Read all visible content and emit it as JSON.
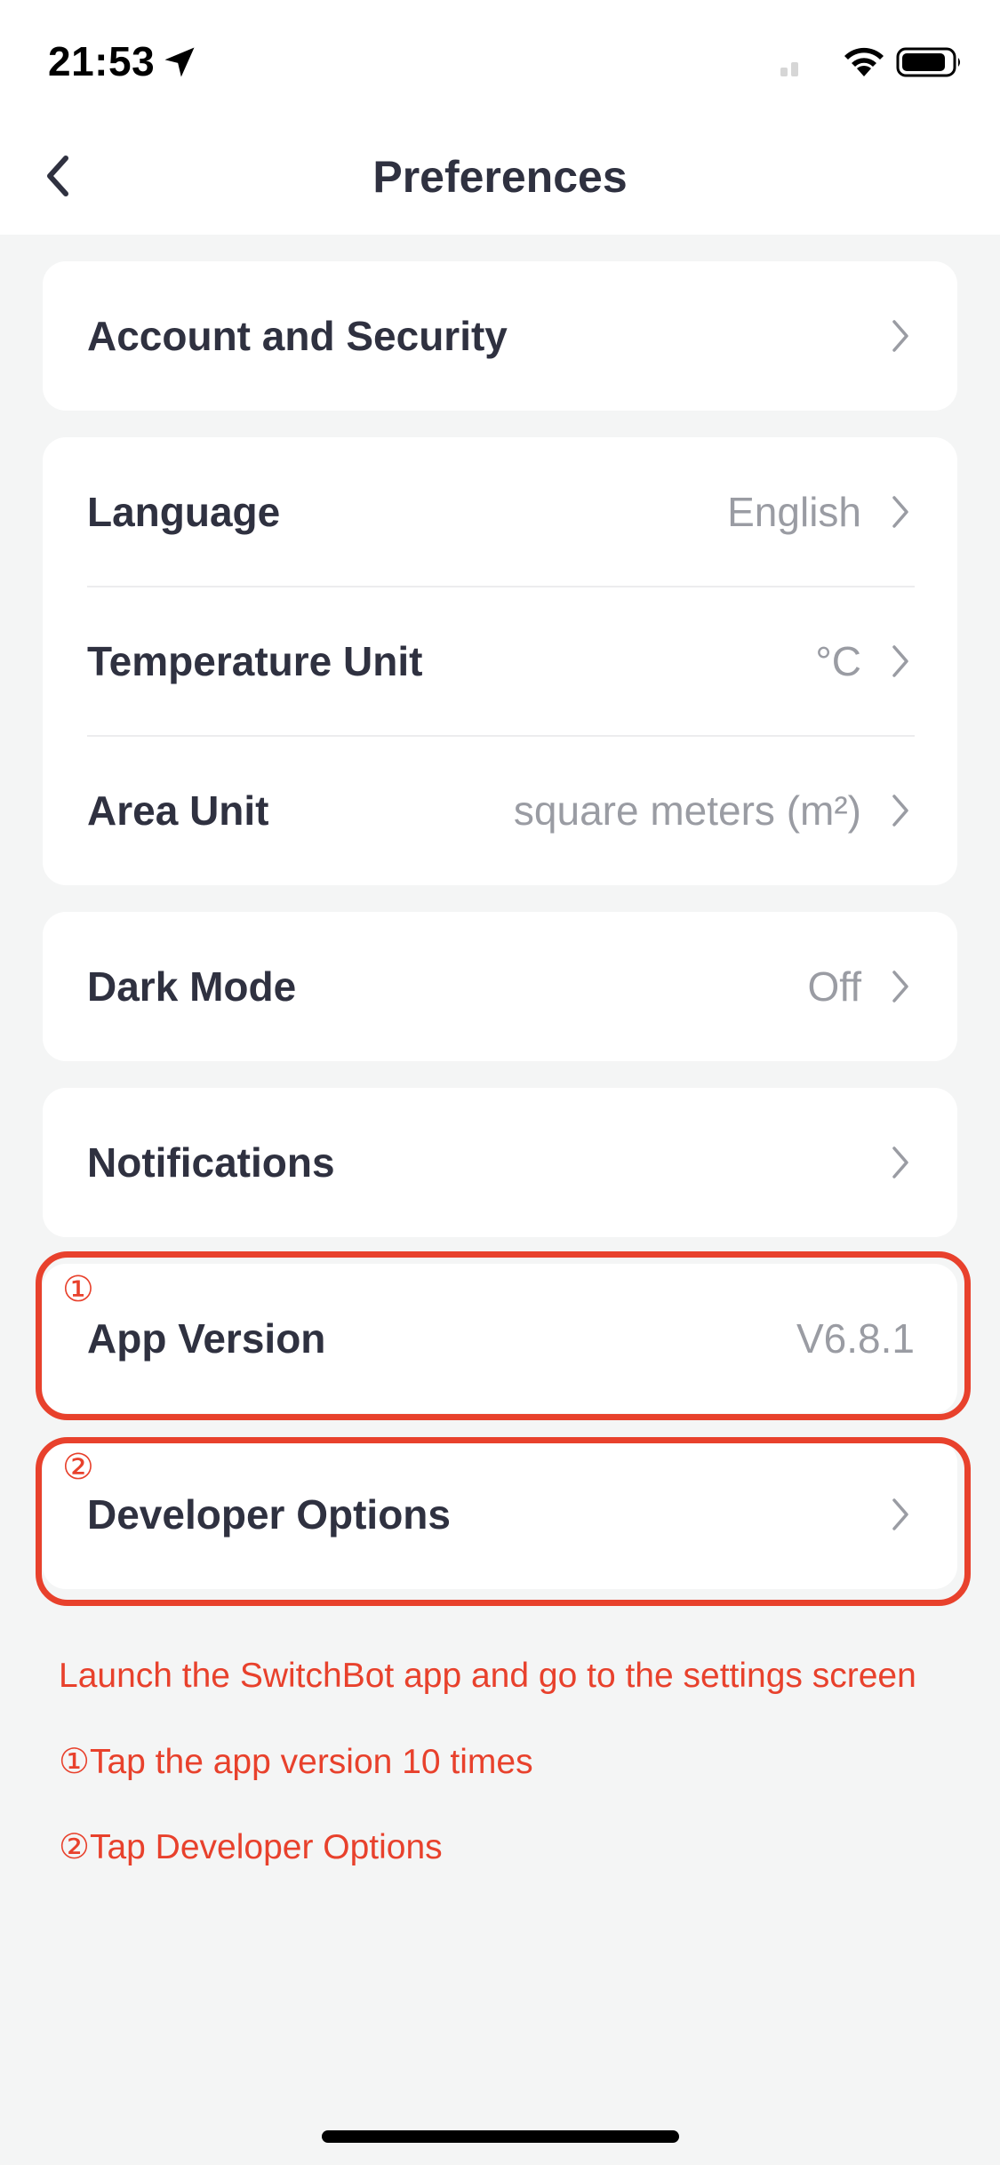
{
  "status_bar": {
    "time": "21:53"
  },
  "header": {
    "title": "Preferences"
  },
  "settings": {
    "account_security": {
      "label": "Account and Security"
    },
    "language": {
      "label": "Language",
      "value": "English"
    },
    "temperature_unit": {
      "label": "Temperature Unit",
      "value": "°C"
    },
    "area_unit": {
      "label": "Area Unit",
      "value": "square meters (m²)"
    },
    "dark_mode": {
      "label": "Dark Mode",
      "value": "Off"
    },
    "notifications": {
      "label": "Notifications"
    },
    "app_version": {
      "label": "App Version",
      "value": "V6.8.1"
    },
    "developer_options": {
      "label": "Developer Options"
    }
  },
  "annotations": {
    "marker_1": "①",
    "marker_2": "②",
    "accent_color": "#e8412c",
    "instructions": [
      "Launch the SwitchBot app and go to the settings screen",
      "①Tap the app version 10 times",
      "②Tap Developer Options"
    ]
  },
  "icons": [
    "location-arrow-icon",
    "signal-icon",
    "wifi-icon",
    "battery-icon",
    "back-chevron-icon",
    "chevron-right-icon"
  ]
}
